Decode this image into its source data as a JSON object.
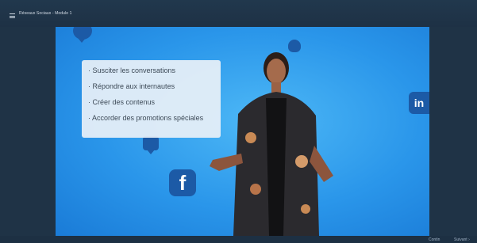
{
  "header": {
    "menu_icon": "hamburger-menu-icon",
    "title": "Réseaux Sociaux - Module 1"
  },
  "slide": {
    "bullets": [
      "· Susciter les conversations",
      "· Répondre aux internautes",
      "· Créer des contenus",
      "· Accorder des promotions spéciales"
    ],
    "facebook_glyph": "f",
    "linkedin_glyph": "in",
    "background_color": "#2a96ea",
    "icon_color": "#1c5aa6"
  },
  "footer": {
    "prev_label": "Contin",
    "next_label": "Suivant ›"
  }
}
